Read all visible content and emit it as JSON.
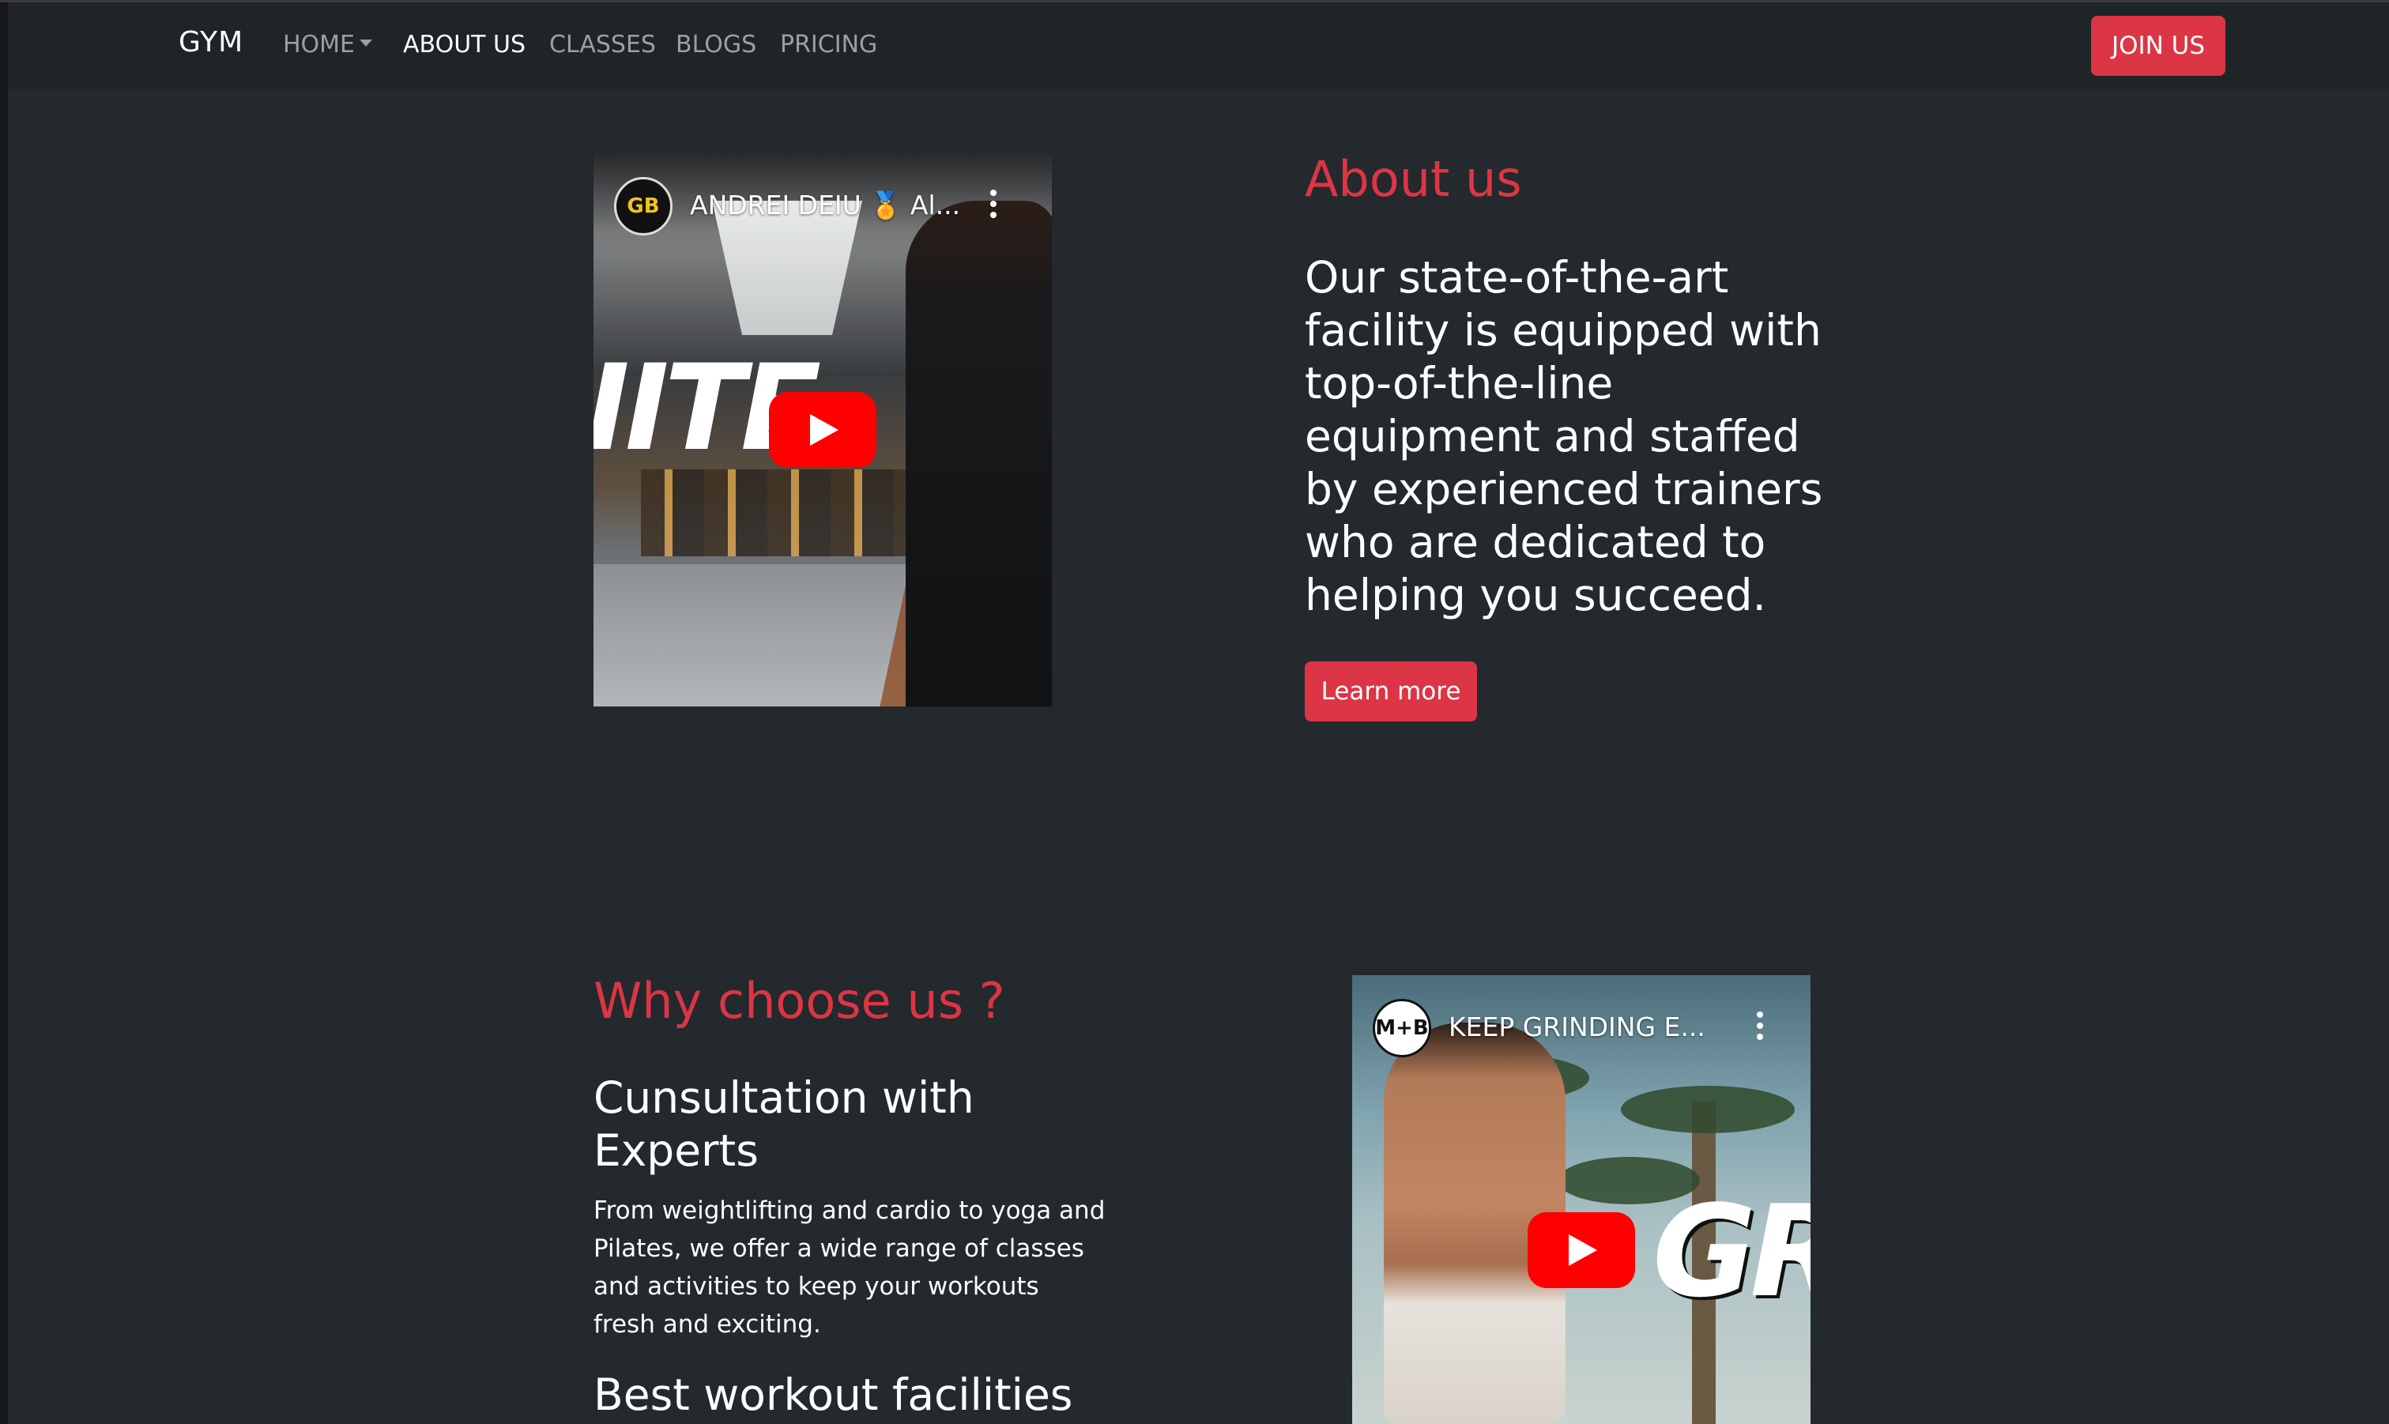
{
  "navbar": {
    "brand": "GYM",
    "items": [
      {
        "label": "HOME",
        "has_dropdown": true,
        "active": false
      },
      {
        "label": "ABOUT US",
        "has_dropdown": false,
        "active": true
      },
      {
        "label": "CLASSES",
        "has_dropdown": false,
        "active": false
      },
      {
        "label": "BLOGS",
        "has_dropdown": false,
        "active": false
      },
      {
        "label": "PRICING",
        "has_dropdown": false,
        "active": false
      }
    ],
    "join_label": "JOIN US"
  },
  "about": {
    "heading": "About us",
    "text": "Our state-of-the-art facility is equipped with top-of-the-line equipment and staffed by experienced trainers who are dedicated to helping you succeed.",
    "button_label": "Learn more",
    "video": {
      "channel_avatar": "GB",
      "title": "ANDREI DEIU 🏅 Al...",
      "overlay_text": "IITE"
    }
  },
  "why": {
    "heading": "Why choose us ?",
    "features": [
      {
        "title": "Cunsultation with Experts",
        "text": "From weightlifting and cardio to yoga and Pilates, we offer a wide range of classes and activities to keep your workouts fresh and exciting."
      },
      {
        "title": "Best workout facilities"
      }
    ],
    "video": {
      "channel_avatar": "M+B",
      "title": "KEEP GRINDING E...",
      "overlay_text": "GRI"
    }
  },
  "colors": {
    "accent": "#dc3545",
    "background": "#23292c",
    "navbar": "#1f2427",
    "youtube_red": "#ff0000"
  }
}
